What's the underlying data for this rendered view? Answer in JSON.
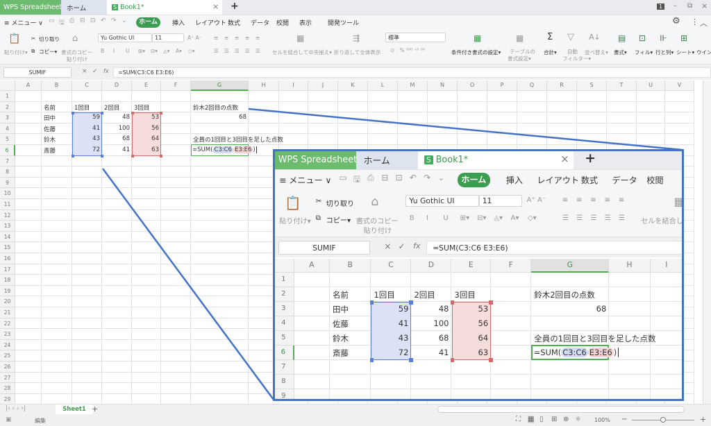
{
  "window": {
    "app_tab": "WPS Spreadsheets",
    "home_tab": "ホーム",
    "doc_tab": "Book1*",
    "doc_icon": "S",
    "new_tab": "+",
    "close": "×",
    "badge": "1",
    "minimize": "–",
    "restore": "⧉"
  },
  "menu": {
    "menu_label": "≡ メニュー ∨",
    "tabs": [
      "ホーム",
      "挿入",
      "レイアウト",
      "数式",
      "データ",
      "校閲",
      "表示",
      "開発ツール"
    ],
    "active_tab": "ホーム",
    "gear": "⚙",
    "more": "⋮",
    "collapse": "︿"
  },
  "ribbon": {
    "paste": "貼り付け▾",
    "cut": "切り取り",
    "copy": "コピー▾",
    "format_copy": "書式のコピー",
    "format_paste": "貼り付け",
    "font_name": "Yu Gothic UI",
    "font_size": "11",
    "merge": "セルを結合して中央揃え▾",
    "wrap": "折り返して全体表示",
    "number_format": "標準",
    "conditional": "条件付き書式の設定▾",
    "table_format_1": "テーブルの",
    "table_format_2": "書式設定▾",
    "sum": "合計▾",
    "autofilter_1": "自動",
    "autofilter_2": "フィルター▾",
    "sort": "並べ替え▾",
    "format": "書式▾",
    "fill": "フィル▾",
    "rowcol": "行と列▾",
    "sheet": "シート▾",
    "window": "ウイン"
  },
  "formula_bar": {
    "name_box": "SUMIF",
    "cancel": "×",
    "confirm": "✓",
    "fx": "fx",
    "formula": "=SUM(C3:C6 E3:E6)"
  },
  "sheet": {
    "columns": [
      "A",
      "B",
      "C",
      "D",
      "E",
      "F",
      "G",
      "H",
      "I",
      "J",
      "K",
      "L",
      "M",
      "N",
      "O",
      "P",
      "Q",
      "R",
      "S",
      "T",
      "U",
      "V"
    ],
    "row_count": 29,
    "active_cell": "G6",
    "cells": [
      {
        "ref": "B2",
        "value": "名前"
      },
      {
        "ref": "C2",
        "value": "1回目"
      },
      {
        "ref": "D2",
        "value": "2回目"
      },
      {
        "ref": "E2",
        "value": "3回目"
      },
      {
        "ref": "G2",
        "value": "鈴木2回目の点数"
      },
      {
        "ref": "B3",
        "value": "田中"
      },
      {
        "ref": "C3",
        "value": "59",
        "num": true
      },
      {
        "ref": "D3",
        "value": "48",
        "num": true
      },
      {
        "ref": "E3",
        "value": "53",
        "num": true
      },
      {
        "ref": "G3",
        "value": "68",
        "num": true
      },
      {
        "ref": "B4",
        "value": "佐藤"
      },
      {
        "ref": "C4",
        "value": "41",
        "num": true
      },
      {
        "ref": "D4",
        "value": "100",
        "num": true
      },
      {
        "ref": "E4",
        "value": "56",
        "num": true
      },
      {
        "ref": "B5",
        "value": "鈴木"
      },
      {
        "ref": "C5",
        "value": "43",
        "num": true
      },
      {
        "ref": "D5",
        "value": "68",
        "num": true
      },
      {
        "ref": "E5",
        "value": "64",
        "num": true
      },
      {
        "ref": "G5",
        "value": "全員の1回目と3回目を足した点数"
      },
      {
        "ref": "B6",
        "value": "斎藤"
      },
      {
        "ref": "C6",
        "value": "72",
        "num": true
      },
      {
        "ref": "D6",
        "value": "41",
        "num": true
      },
      {
        "ref": "E6",
        "value": "63",
        "num": true
      }
    ],
    "formula_parts": [
      "=SUM(",
      "C3:C6",
      "E3:E6",
      ")"
    ],
    "ranges": [
      {
        "ref": "C3:C6",
        "fill": "#dbe2f6",
        "border": "#5a7fd8"
      },
      {
        "ref": "E3:E6",
        "fill": "#f7dcdc",
        "border": "#d46a6a"
      }
    ],
    "sheet_tab": "Sheet1",
    "add_sheet": "+"
  },
  "status": {
    "mode": "編集",
    "zoom": "100%",
    "zoom_level": 0.5,
    "zoom_minus": "−",
    "zoom_plus": "+"
  },
  "colors": {
    "accent": "#3a9d4f",
    "callout": "#4472c4",
    "app_tab": "#6cbb6f"
  }
}
